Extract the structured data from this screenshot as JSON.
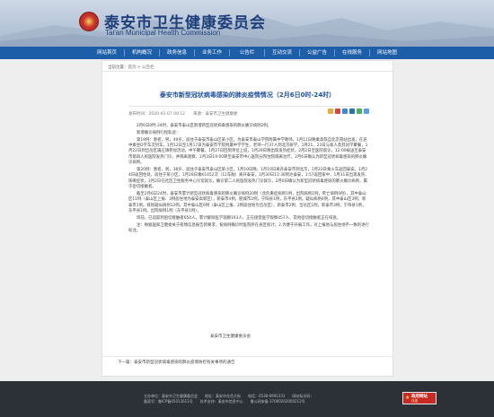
{
  "site": {
    "title": "泰安市卫生健康委员会",
    "subtitle": "Tai'an Municipal Health Commission"
  },
  "nav": {
    "items": [
      {
        "label": "网站首页"
      },
      {
        "label": "机构概况"
      },
      {
        "label": "政务信息"
      },
      {
        "label": "业务工作"
      },
      {
        "label": "公告栏"
      },
      {
        "label": "互动交流"
      },
      {
        "label": "公益广告"
      },
      {
        "label": "在线服务"
      },
      {
        "label": "网站地图"
      }
    ]
  },
  "breadcrumb": "当前位置：首页 > 公告栏",
  "article": {
    "title": "泰安市新型冠状病毒感染的肺炎疫情情况（2月6日0时-24时）",
    "meta": "发布时间：2020-02-07 09:12　　来源：泰安市卫生健康委",
    "paragraphs": [
      "2月6日0时-24时，泰安市泰山区新增新型冠状病毒感染的肺炎确诊病例2例。",
      "新增确诊病例行程轨迹：",
      "第19例：患者，男，49岁，居住于泰安市泰山区某小区，为泰安市泰山学院附属中学教师。1月11日晚乘高铁自北京南站出发，在途中乘坐D字车次列车，1月12日至1月17日为泰安市学院附属中学学生、老师一行37人到北京研学，1月21、23日与家人及其同学聚餐，1月22日到岱岳区满庄镇参加活动，中午聚餐。1月27日回到单位上班，1月29日晚出现发热症状，2月2日至医院就诊，12:00被送至泰安市第四人民医院发热门诊，并隔离观察，2月3日19:00转至泰安市中心医院分院住院隔离治疗，2月6日确认为新型冠状病毒感染的肺炎确诊病例。",
      "第20例：患者，男，38岁，居住于泰安市泰山区某小区，1月10日晚，1月10日离开泰安市到北京，1月23日乘火车返回泰安，1月24日返回住处，居住于某小区，1月28日乘K1452次（12车厢）离开泰安，1月30日13:38到达泰安，1:57返回家中，1月31日出现发热、咳嗽症状，2月2日在社区卫生服务中心诊室就诊，确诊第二人民医院发热门诊就诊，2月6日确认为新型冠状病毒感染的肺炎确诊病例，属于密切接触者。",
      "截至2月6日24时，泰安市累计新型冠状病毒感染的肺炎确诊病例20例（含危重症病例1例，出院病例1例，死亡病例0例），其中泰山区11例（泰山区上报、3例居住地为泰安高新区），新泰市4例，肥城市2例，宁阳县1例，东平县2例。疑似病例4例，其中泰山区3例，新泰市1例。排除疑似病例12例，其中泰山区6例（泰山区上报、2例居住地为岱岳区），新泰市2例，岱岳区1例，新泰市3例，宁阳县1例，东平县1例。出院病例1例（东平县1例）。",
      "目前，已追踪到密切接触者650人，累计解除医学观察193人，正在接受医学观察457人，其他密切接触者正在排查。",
      "注：根据国家卫健委关于疫情信息报告新要求，按病例确诊时医院所在县区统计；2.为便于开展工作，对上报地与居住地不一致的进行标注。"
    ],
    "signature": "泰安市卫生健康委员会",
    "next_link": "下一篇：泰安市新型冠状病毒感染的肺炎疫情防控有关事项的通告"
  },
  "footer": {
    "lines": [
      "主办单位：泰安市卫生健康委员会　　地址：泰安市东岳大街　　电话：0538-6991331　　网站标识码：",
      "备案号：鲁ICP备05013611号　　技术支持：泰安市信息中心　　鲁公网安备 37090202000212号"
    ],
    "badge_line1": "政府网站",
    "badge_line2": "找错"
  },
  "colors": {
    "nav_bg": "#1c5ea8",
    "title_blue": "#1f4f9a",
    "footer_bg": "#2c3138",
    "badge_red": "#c72a25"
  },
  "icons": [
    "emblem-icon",
    "share-qzone-icon",
    "share-weibo-icon",
    "share-tencent-icon",
    "share-renren-icon",
    "share-wechat-icon",
    "share-more-icon",
    "star-icon"
  ]
}
